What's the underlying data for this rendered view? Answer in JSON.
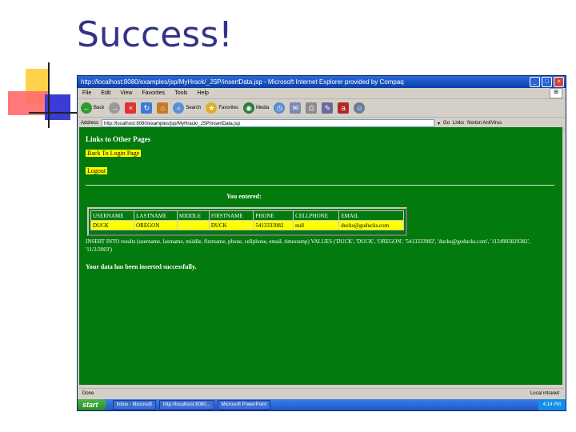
{
  "slide": {
    "title": "Success!"
  },
  "window": {
    "title": "http://localhost:8080/examples/jsp/MyHrack/_JSP/insertData.jsp - Microsoft Internet Explorer provided by Compaq",
    "menu": [
      "File",
      "Edit",
      "View",
      "Favorites",
      "Tools",
      "Help"
    ],
    "toolbar": {
      "back": "Back",
      "search": "Search",
      "favorites": "Favorites",
      "media": "Media"
    },
    "address": {
      "label": "Address",
      "value": "http://localhost:8080/examples/jsp/MyHrack/_JSP/insertData.jsp",
      "go": "Go",
      "links": "Links",
      "norton": "Norton AntiVirus"
    }
  },
  "page": {
    "links_heading": "Links to Other Pages",
    "back_link": "Back To Login Page",
    "logout_link": "Logout",
    "entered_heading": "You entered:",
    "table": {
      "headers": [
        "USERNAME",
        "LASTNAME",
        "MIDDLE",
        "FIRSTNAME",
        "PHONE",
        "CELLPHONE",
        "EMAIL"
      ],
      "row": [
        "DUCK",
        "OREGON",
        "",
        "DUCK",
        "5413333982",
        "null",
        "ducks@goducks.com"
      ]
    },
    "sql": "INSERT INTO results (username, lastname, middle, firstname, phone, cellphone, email, timestamp) VALUES ('DUCK', 'DUCK', 'OREGON', '5413333982', 'ducks@goducks.com', '1124903829382', '11/2/2003')",
    "success_message": "Your data has been inserted successfully."
  },
  "status": {
    "left": "Done",
    "right": "Local intranet"
  },
  "taskbar": {
    "start": "start",
    "tasks": [
      "Inbox - Microsoft",
      "http://localhost:8080...",
      "Microsoft PowerPoint"
    ],
    "clock": "4:14 PM"
  }
}
